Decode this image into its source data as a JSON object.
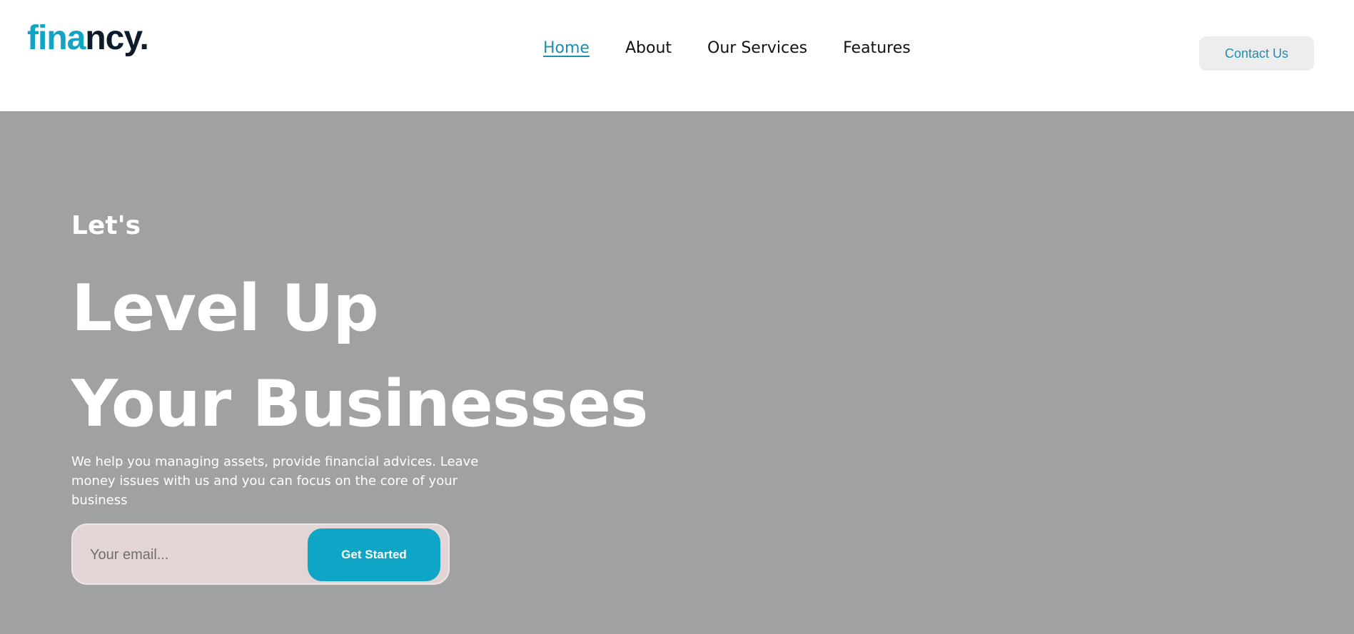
{
  "brand": {
    "logo_accent": "fina",
    "logo_rest": "ncy."
  },
  "nav": {
    "items": [
      {
        "label": "Home",
        "active": true
      },
      {
        "label": "About",
        "active": false
      },
      {
        "label": "Our Services",
        "active": false
      },
      {
        "label": "Features",
        "active": false
      }
    ]
  },
  "header": {
    "contact_label": "Contact Us"
  },
  "hero": {
    "pretitle": "Let's",
    "title_line1": "Level Up",
    "title_line2": "Your Businesses",
    "description": "We help you managing assets, provide financial advices. Leave money issues with us and you can focus on the core of your business",
    "email_placeholder": "Your email...",
    "cta_label": "Get Started"
  },
  "colors": {
    "accent": "#12a4c4",
    "hero_bg": "#a0a1a3",
    "logo_dark": "#0d1b2a",
    "signup_bg": "#e3d5d5"
  }
}
